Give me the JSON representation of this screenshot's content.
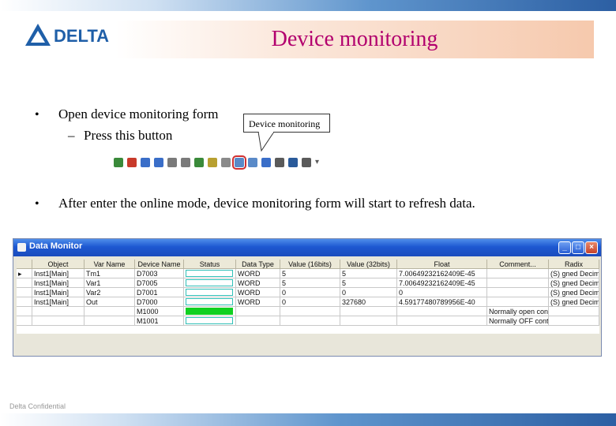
{
  "header": {
    "logo_text": "DELTA",
    "title": "Device monitoring"
  },
  "bullets": [
    {
      "text": "Open device monitoring form"
    },
    {
      "text": "After enter the online mode, device monitoring form will start to refresh data."
    }
  ],
  "sub_bullet": {
    "dash": "–",
    "text": "Press this button"
  },
  "callout": {
    "text": "Device monitoring"
  },
  "toolbar": {
    "icons": [
      {
        "name": "go-icon",
        "color": "#3a8a3a"
      },
      {
        "name": "stop-icon",
        "color": "#c83a2a"
      },
      {
        "name": "upload-icon",
        "color": "#3a6ec8"
      },
      {
        "name": "download-icon",
        "color": "#3a6ec8"
      },
      {
        "name": "compare-icon",
        "color": "#7a7a7a"
      },
      {
        "name": "transfer-icon",
        "color": "#7a7a7a"
      },
      {
        "name": "run-icon",
        "color": "#3a8a3a"
      },
      {
        "name": "wand-icon",
        "color": "#b8a030"
      },
      {
        "name": "monitor-icon",
        "color": "#8a8a8a"
      },
      {
        "name": "device-monitor-icon",
        "color": "#5a8ac8"
      },
      {
        "name": "tool-icon",
        "color": "#5a8ac8"
      },
      {
        "name": "online-icon",
        "color": "#3a6ec8"
      },
      {
        "name": "network-icon",
        "color": "#5a5a5a"
      },
      {
        "name": "search-icon",
        "color": "#2a5a9a"
      },
      {
        "name": "settings-icon",
        "color": "#5a5a5a"
      },
      {
        "name": "dropdown-icon",
        "color": "#5a5a5a"
      }
    ]
  },
  "window": {
    "title": "Data Monitor",
    "columns": [
      "Object",
      "Var Name",
      "Device Name",
      "Status",
      "Data Type",
      "Value (16bits)",
      "Value (32bits)",
      "Float",
      "Comment...",
      "Radix"
    ],
    "rows": [
      {
        "marker": "▸",
        "object": "Inst1[Main]",
        "var_name": "Tm1",
        "device": "D7003",
        "status": "empty",
        "data_type": "WORD",
        "v16": "5",
        "v32": "5",
        "float": "7.00649232162409E-45",
        "comment": "",
        "radix": "(S) gned Decima"
      },
      {
        "marker": "",
        "object": "Inst1[Main]",
        "var_name": "Var1",
        "device": "D7005",
        "status": "empty",
        "data_type": "WORD",
        "v16": "5",
        "v32": "5",
        "float": "7.00649232162409E-45",
        "comment": "",
        "radix": "(S) gned Decima"
      },
      {
        "marker": "",
        "object": "Inst1[Main]",
        "var_name": "Var2",
        "device": "D7001",
        "status": "empty",
        "data_type": "WORD",
        "v16": "0",
        "v32": "0",
        "float": "0",
        "comment": "",
        "radix": "(S) gned Decima"
      },
      {
        "marker": "",
        "object": "Inst1[Main]",
        "var_name": "Out",
        "device": "D7000",
        "status": "empty",
        "data_type": "WORD",
        "v16": "0",
        "v32": "327680",
        "float": "4.59177480789956E-40",
        "comment": "",
        "radix": "(S) gned Decima"
      },
      {
        "marker": "",
        "object": "",
        "var_name": "",
        "device": "M1000",
        "status": "on",
        "data_type": "",
        "v16": "",
        "v32": "",
        "float": "",
        "comment": "Normally open conta",
        "radix": ""
      },
      {
        "marker": "",
        "object": "",
        "var_name": "",
        "device": "M1001",
        "status": "empty",
        "data_type": "",
        "v16": "",
        "v32": "",
        "float": "",
        "comment": "Normally OFF conta",
        "radix": ""
      }
    ]
  },
  "footer": {
    "text": "Delta Confidential"
  }
}
